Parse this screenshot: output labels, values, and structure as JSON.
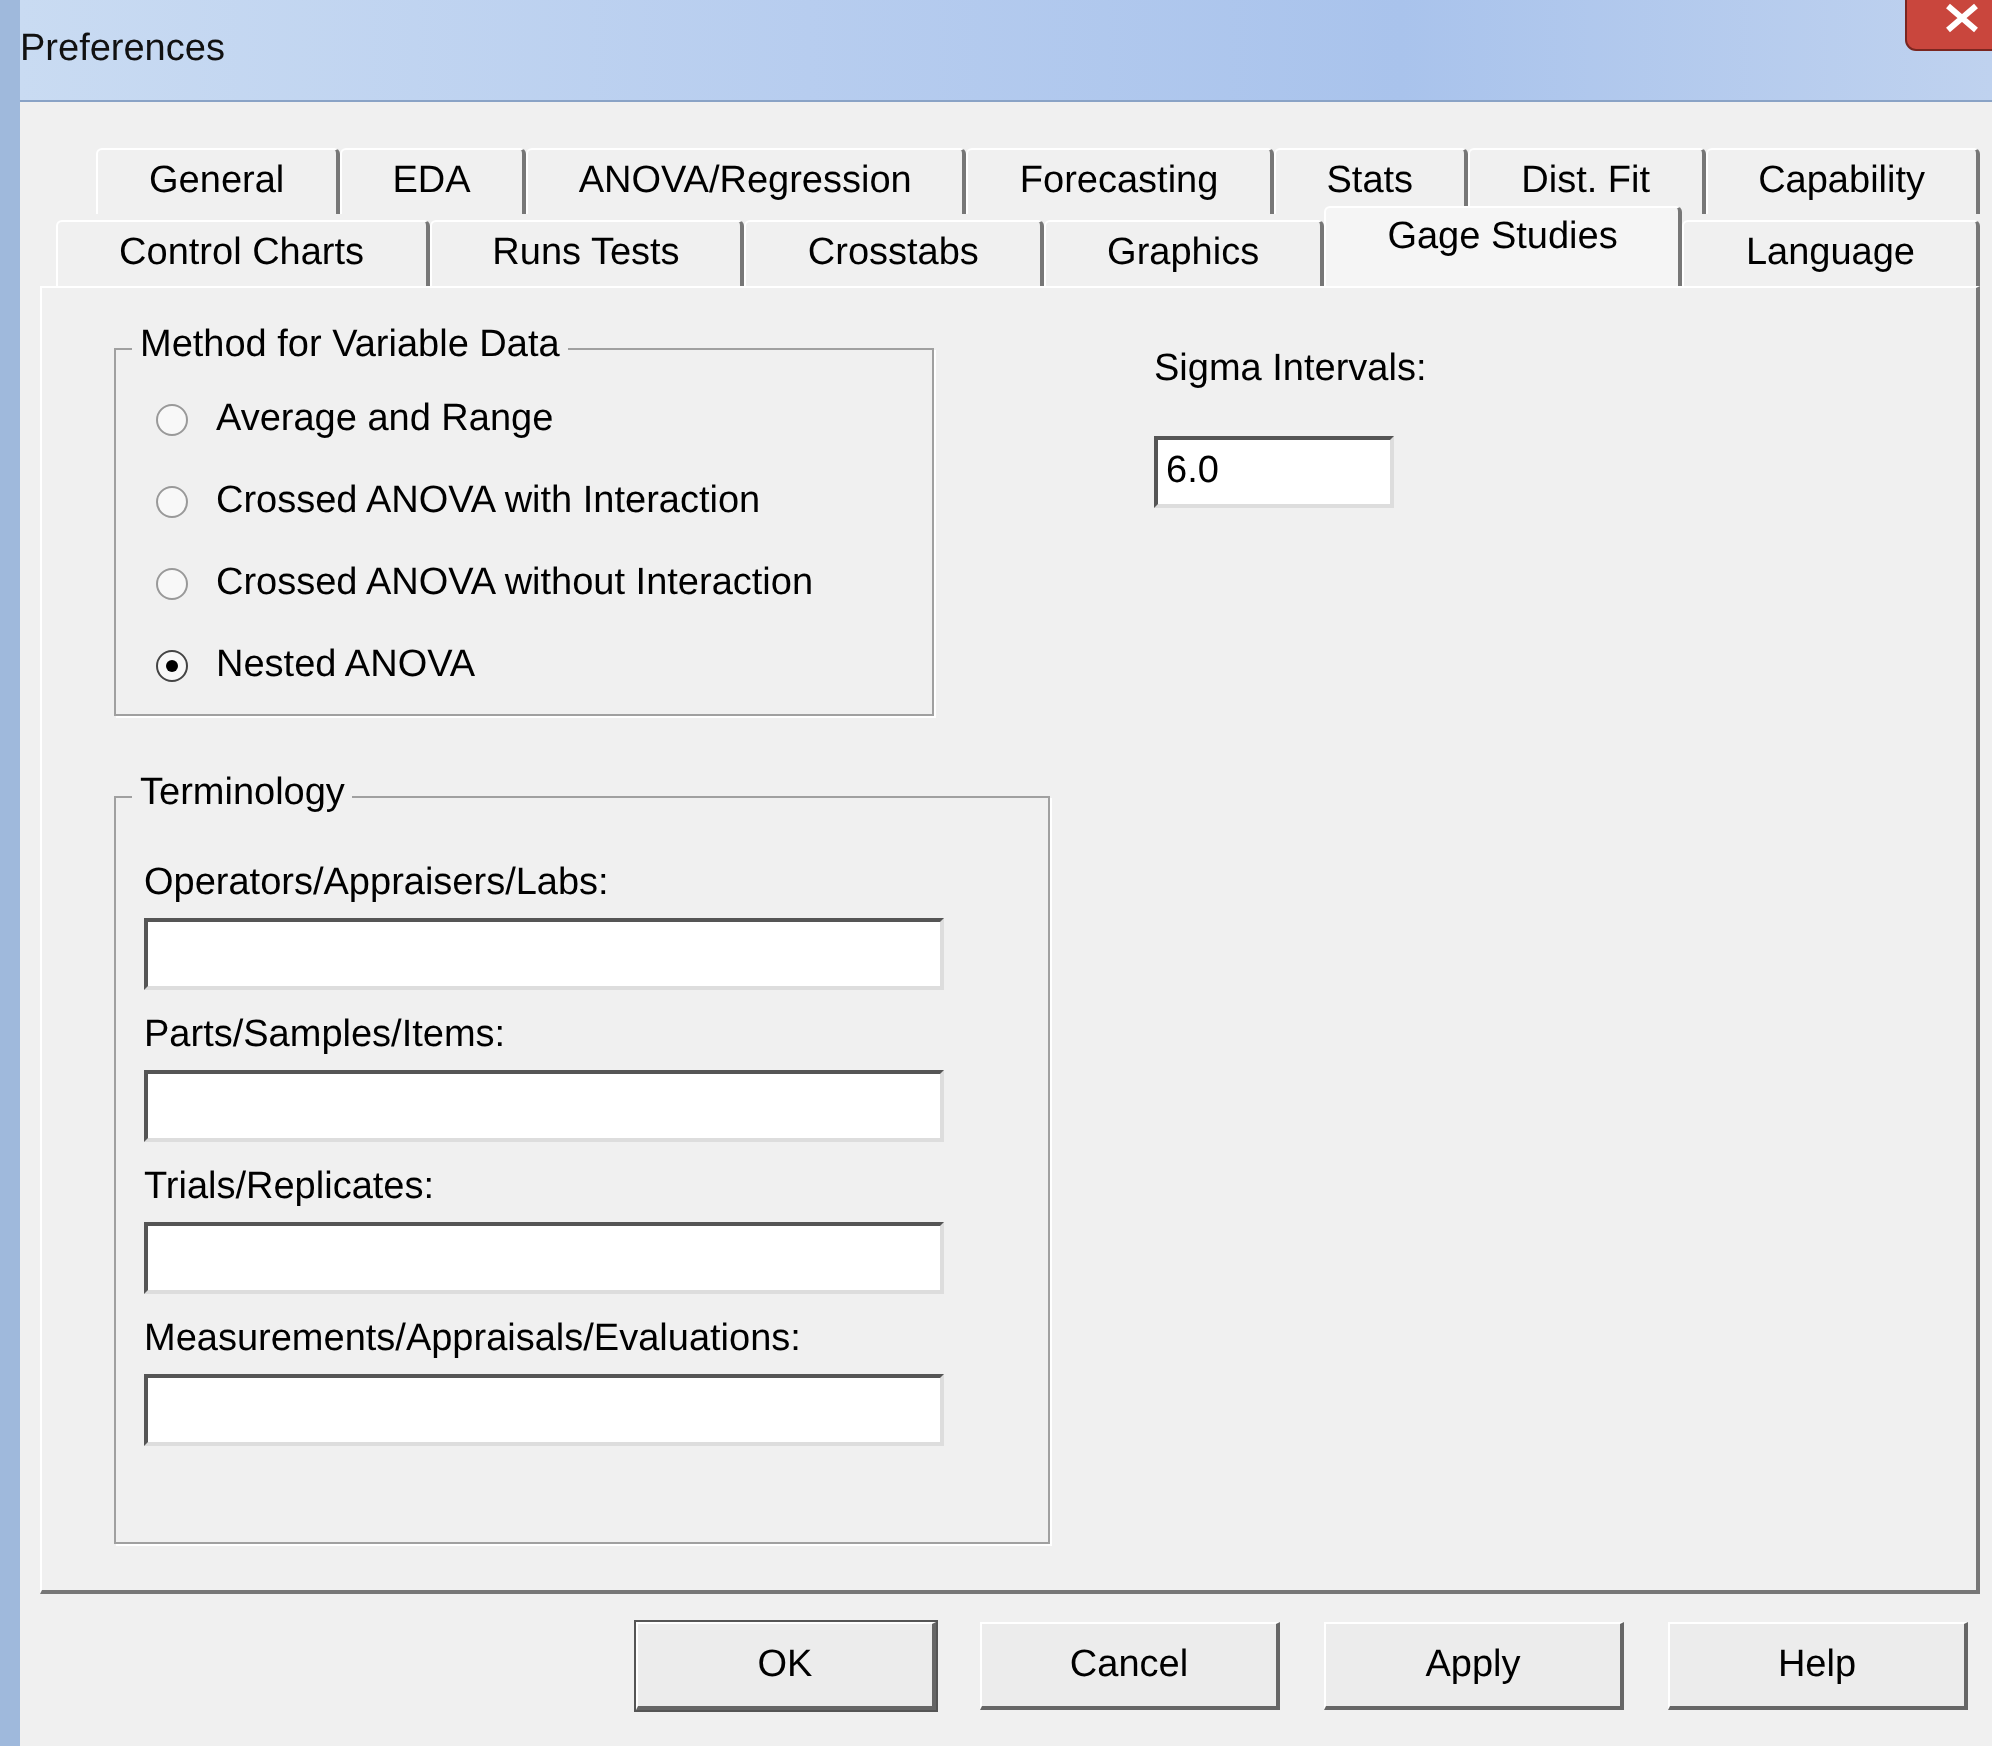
{
  "window": {
    "title": "Preferences"
  },
  "tab_rows": [
    [
      {
        "label": "General",
        "selected": false
      },
      {
        "label": "EDA",
        "selected": false
      },
      {
        "label": "ANOVA/Regression",
        "selected": false
      },
      {
        "label": "Forecasting",
        "selected": false
      },
      {
        "label": "Stats",
        "selected": false
      },
      {
        "label": "Dist. Fit",
        "selected": false
      },
      {
        "label": "Capability",
        "selected": false
      }
    ],
    [
      {
        "label": "Control Charts",
        "selected": false
      },
      {
        "label": "Runs Tests",
        "selected": false
      },
      {
        "label": "Crosstabs",
        "selected": false
      },
      {
        "label": "Graphics",
        "selected": false
      },
      {
        "label": "Gage Studies",
        "selected": true
      },
      {
        "label": "Language",
        "selected": false
      }
    ]
  ],
  "method_group": {
    "title": "Method for Variable Data",
    "options": [
      {
        "label": "Average and Range",
        "selected": false
      },
      {
        "label": "Crossed ANOVA with Interaction",
        "selected": false
      },
      {
        "label": "Crossed ANOVA without Interaction",
        "selected": false
      },
      {
        "label": "Nested ANOVA",
        "selected": true
      }
    ]
  },
  "sigma": {
    "label": "Sigma Intervals:",
    "value": "6.0"
  },
  "terminology_group": {
    "title": "Terminology",
    "fields": [
      {
        "label": "Operators/Appraisers/Labs:"
      },
      {
        "label": "Parts/Samples/Items:"
      },
      {
        "label": "Trials/Replicates:"
      },
      {
        "label": "Measurements/Appraisals/Evaluations:"
      }
    ]
  },
  "buttons": [
    {
      "label": "OK",
      "default": true
    },
    {
      "label": "Cancel",
      "default": false
    },
    {
      "label": "Apply",
      "default": false
    },
    {
      "label": "Help",
      "default": false
    }
  ]
}
